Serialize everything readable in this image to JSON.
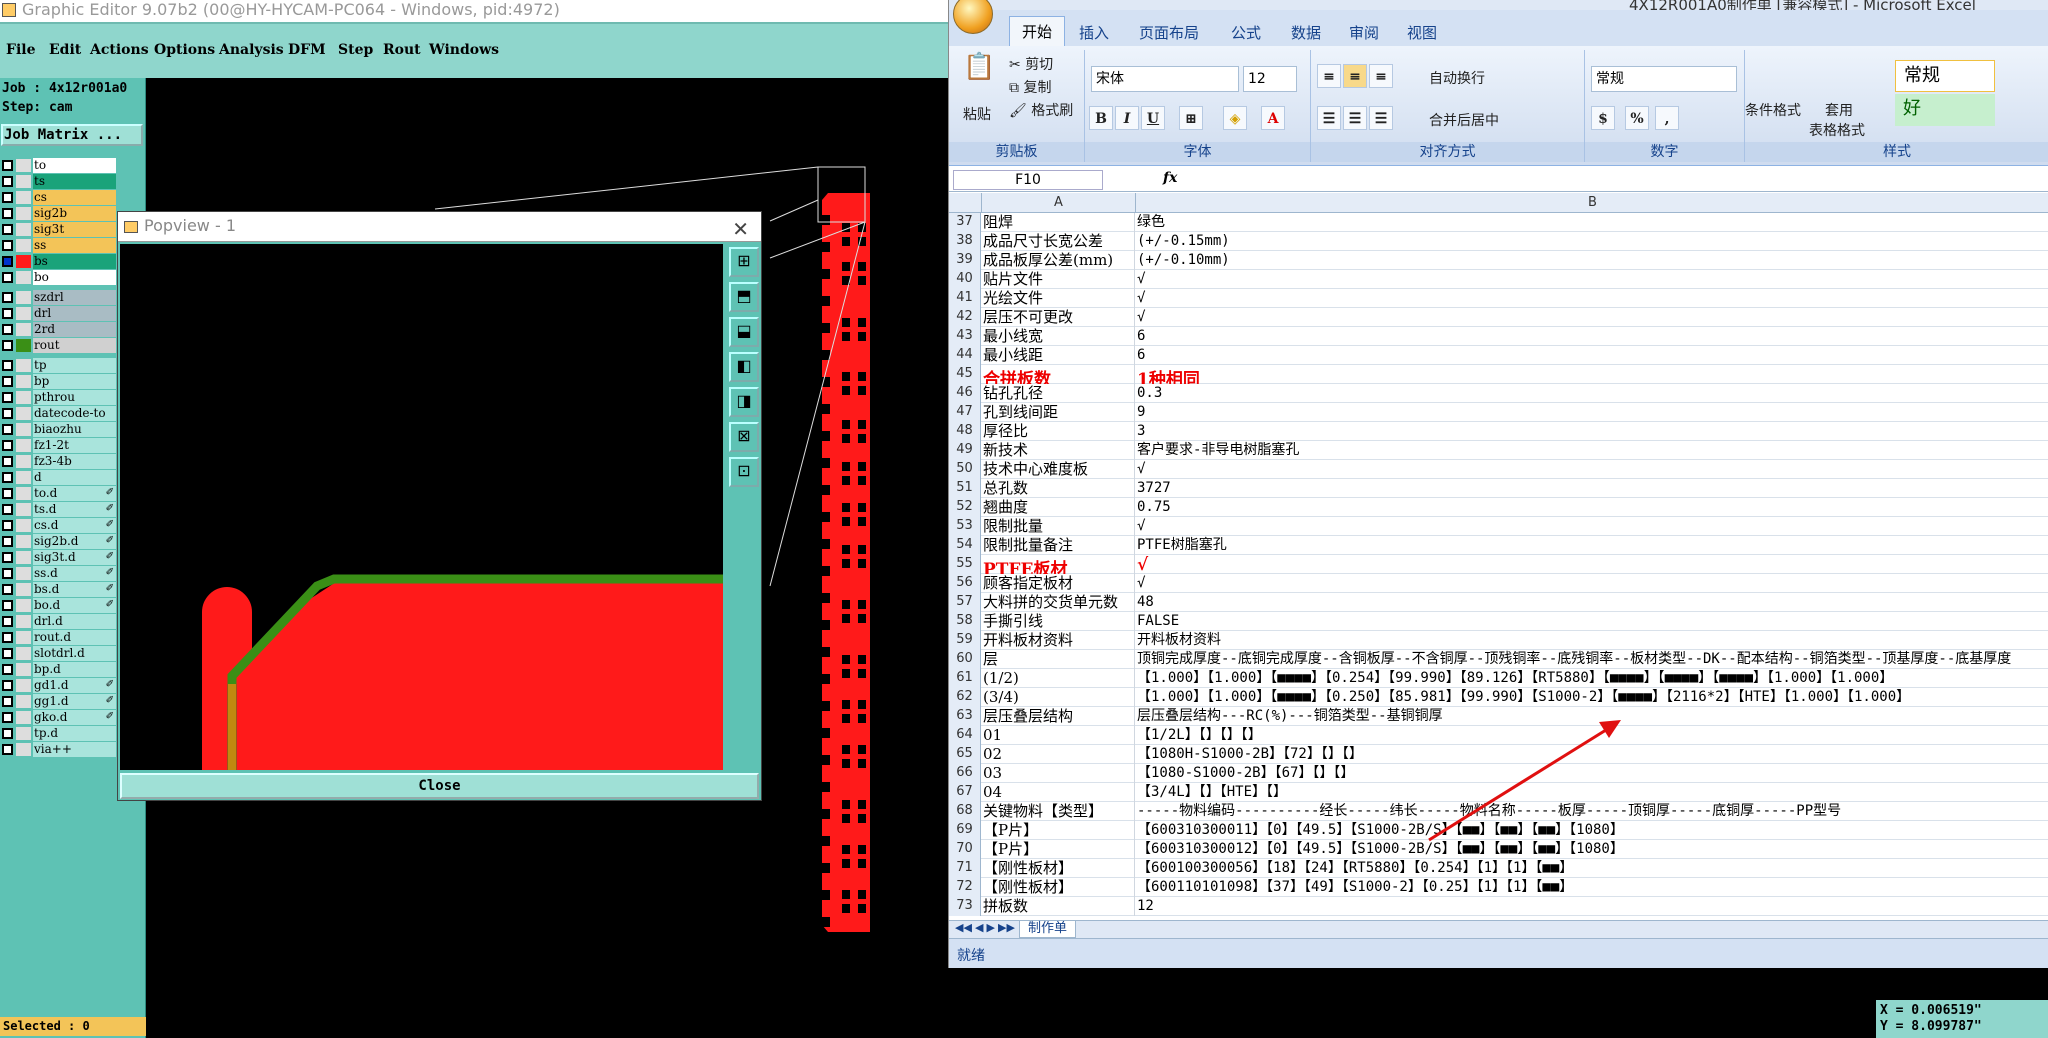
{
  "ge": {
    "title": "Graphic Editor 9.07b2 (00@HY-HYCAM-PC064 - Windows, pid:4972)",
    "menu": [
      "File",
      "Edit",
      "Actions",
      "Options",
      "Analysis",
      "DFM",
      "Step",
      "Rout",
      "Windows"
    ],
    "job": "Job : 4x12r001a0",
    "step": "Step: cam",
    "job_matrix": "Job Matrix ...",
    "layers": [
      {
        "name": "to",
        "color": "#ffffff",
        "marked": false
      },
      {
        "name": "ts",
        "color": "#1aa37a",
        "marked": false
      },
      {
        "name": "cs",
        "color": "#f3c458",
        "marked": false
      },
      {
        "name": "sig2b",
        "color": "#f3c458",
        "marked": false
      },
      {
        "name": "sig3t",
        "color": "#f3c458",
        "marked": false
      },
      {
        "name": "ss",
        "color": "#f3c458",
        "marked": false
      },
      {
        "name": "bs",
        "color": "#1aa37a",
        "marked": false
      },
      {
        "name": "bo",
        "color": "#ffffff",
        "marked": false
      },
      {
        "name": "szdrl",
        "color": "#a9bcc4",
        "marked": false
      },
      {
        "name": "drl",
        "color": "#a9bcc4",
        "marked": false
      },
      {
        "name": "2rd",
        "color": "#a9bcc4",
        "marked": false
      },
      {
        "name": "rout",
        "color": "#d0d0d0",
        "marked": false
      },
      {
        "name": "tp",
        "color": "#a9e4dc",
        "marked": false
      },
      {
        "name": "bp",
        "color": "#a9e4dc",
        "marked": false
      },
      {
        "name": "pthrou",
        "color": "#a9e4dc",
        "marked": false
      },
      {
        "name": "datecode-to",
        "color": "#a9e4dc",
        "marked": false
      },
      {
        "name": "biaozhu",
        "color": "#a9e4dc",
        "marked": false
      },
      {
        "name": "fz1-2t",
        "color": "#a9e4dc",
        "marked": false
      },
      {
        "name": "fz3-4b",
        "color": "#a9e4dc",
        "marked": false
      },
      {
        "name": "d",
        "color": "#a9e4dc",
        "marked": false
      },
      {
        "name": "to.d",
        "color": "#a9e4dc",
        "marked": true
      },
      {
        "name": "ts.d",
        "color": "#a9e4dc",
        "marked": true
      },
      {
        "name": "cs.d",
        "color": "#a9e4dc",
        "marked": true
      },
      {
        "name": "sig2b.d",
        "color": "#a9e4dc",
        "marked": true
      },
      {
        "name": "sig3t.d",
        "color": "#a9e4dc",
        "marked": true
      },
      {
        "name": "ss.d",
        "color": "#a9e4dc",
        "marked": true
      },
      {
        "name": "bs.d",
        "color": "#a9e4dc",
        "marked": true
      },
      {
        "name": "bo.d",
        "color": "#a9e4dc",
        "marked": true
      },
      {
        "name": "drl.d",
        "color": "#a9e4dc",
        "marked": false
      },
      {
        "name": "rout.d",
        "color": "#a9e4dc",
        "marked": false
      },
      {
        "name": "slotdrl.d",
        "color": "#a9e4dc",
        "marked": false
      },
      {
        "name": "bp.d",
        "color": "#a9e4dc",
        "marked": false
      },
      {
        "name": "gd1.d",
        "color": "#a9e4dc",
        "marked": true
      },
      {
        "name": "gg1.d",
        "color": "#a9e4dc",
        "marked": true
      },
      {
        "name": "gko.d",
        "color": "#a9e4dc",
        "marked": true
      },
      {
        "name": "tp.d",
        "color": "#a9e4dc",
        "marked": false
      },
      {
        "name": "via++",
        "color": "#a9e4dc",
        "marked": false
      }
    ],
    "selected": "Selected : 0",
    "popview_title": "Popview - 1",
    "popview_close": "Close",
    "coord_x": "X = 0.006519\"",
    "coord_y": "Y = 8.099787\""
  },
  "xl": {
    "title": "4X12R001A0制作单 [兼容模式] - Microsoft Excel",
    "tabs": [
      "开始",
      "插入",
      "页面布局",
      "公式",
      "数据",
      "审阅",
      "视图"
    ],
    "clipboard": {
      "paste": "粘贴",
      "cut": "剪切",
      "copy": "复制",
      "format_painter": "格式刷",
      "label": "剪贴板"
    },
    "font": {
      "name": "宋体",
      "size": "12",
      "label": "字体"
    },
    "alignment": {
      "wrap": "自动换行",
      "merge": "合并后居中",
      "label": "对齐方式"
    },
    "number": {
      "format": "常规",
      "label": "数字"
    },
    "styles": {
      "conditional": "条件格式",
      "table": "套用",
      "table2": "表格格式",
      "normal": "常规",
      "good": "好",
      "label": "样式"
    },
    "name_box": "F10",
    "fx": "fx",
    "col_a": "A",
    "col_b": "B",
    "rows": [
      {
        "n": "37",
        "a": "阻焊",
        "b": "绿色"
      },
      {
        "n": "38",
        "a": "成品尺寸长宽公差",
        "b": "(+/-0.15mm)"
      },
      {
        "n": "39",
        "a": "成品板厚公差(mm)",
        "b": "(+/-0.10mm)"
      },
      {
        "n": "40",
        "a": "贴片文件",
        "b": "√"
      },
      {
        "n": "41",
        "a": "光绘文件",
        "b": "√"
      },
      {
        "n": "42",
        "a": "层压不可更改",
        "b": "√"
      },
      {
        "n": "43",
        "a": "最小线宽",
        "b": "6"
      },
      {
        "n": "44",
        "a": "最小线距",
        "b": "6"
      },
      {
        "n": "45",
        "a": "合拼板数",
        "b": "1种相同",
        "hl": true
      },
      {
        "n": "46",
        "a": "钻孔孔径",
        "b": "0.3"
      },
      {
        "n": "47",
        "a": "孔到线间距",
        "b": "9"
      },
      {
        "n": "48",
        "a": "厚径比",
        "b": "3"
      },
      {
        "n": "49",
        "a": "新技术",
        "b": "客户要求-非导电树脂塞孔"
      },
      {
        "n": "50",
        "a": "技术中心难度板",
        "b": "√"
      },
      {
        "n": "51",
        "a": "总孔数",
        "b": "3727"
      },
      {
        "n": "52",
        "a": "翘曲度",
        "b": "0.75"
      },
      {
        "n": "53",
        "a": "限制批量",
        "b": "√"
      },
      {
        "n": "54",
        "a": "限制批量备注",
        "b": "PTFE树脂塞孔"
      },
      {
        "n": "55",
        "a": "PTFE板材",
        "b": "√",
        "hl": true
      },
      {
        "n": "56",
        "a": "顾客指定板材",
        "b": "√"
      },
      {
        "n": "57",
        "a": "大料拼的交货单元数",
        "b": "48"
      },
      {
        "n": "58",
        "a": "手撕引线",
        "b": "FALSE"
      },
      {
        "n": "59",
        "a": "开料板材资料",
        "b": "开料板材资料"
      },
      {
        "n": "60",
        "a": "层",
        "b": "顶铜完成厚度--底铜完成厚度--含铜板厚--不含铜厚--顶残铜率--底残铜率--板材类型--DK--配本结构--铜箔类型--顶基厚度--底基厚度"
      },
      {
        "n": "61",
        "a": "(1/2)",
        "b": "【1.000】【1.000】【■■■■】【0.254】【99.990】【89.126】【RT5880】【■■■■】【■■■■】【■■■■】【1.000】【1.000】"
      },
      {
        "n": "62",
        "a": "(3/4)",
        "b": "【1.000】【1.000】【■■■■】【0.250】【85.981】【99.990】【S1000-2】【■■■■】【2116*2】【HTE】【1.000】【1.000】"
      },
      {
        "n": "63",
        "a": "层压叠层结构",
        "b": "层压叠层结构---RC(%)---铜箔类型--基铜铜厚"
      },
      {
        "n": "64",
        "a": "01",
        "b": "【1/2L】【】【】【】"
      },
      {
        "n": "65",
        "a": "02",
        "b": "【1080H-S1000-2B】【72】【】【】"
      },
      {
        "n": "66",
        "a": "03",
        "b": "【1080-S1000-2B】【67】【】【】"
      },
      {
        "n": "67",
        "a": "04",
        "b": "【3/4L】【】【HTE】【】"
      },
      {
        "n": "68",
        "a": "关键物料【类型】",
        "b": "-----物料编码----------经长-----纬长-----物料名称-----板厚-----顶铜厚-----底铜厚-----PP型号"
      },
      {
        "n": "69",
        "a": "【P片】",
        "b": "【600310300011】【0】【49.5】【S1000-2B/S】【■■】【■■】【■■】【1080】"
      },
      {
        "n": "70",
        "a": "【P片】",
        "b": "【600310300012】【0】【49.5】【S1000-2B/S】【■■】【■■】【■■】【1080】"
      },
      {
        "n": "71",
        "a": "【刚性板材】",
        "b": "【600100300056】【18】【24】【RT5880】【0.254】【1】【1】【■■】"
      },
      {
        "n": "72",
        "a": "【刚性板材】",
        "b": "【600110101098】【37】【49】【S1000-2】【0.25】【1】【1】【■■】"
      },
      {
        "n": "73",
        "a": "拼板数",
        "b": "12"
      }
    ],
    "sheet_tab": "制作单",
    "status": "就绪"
  }
}
